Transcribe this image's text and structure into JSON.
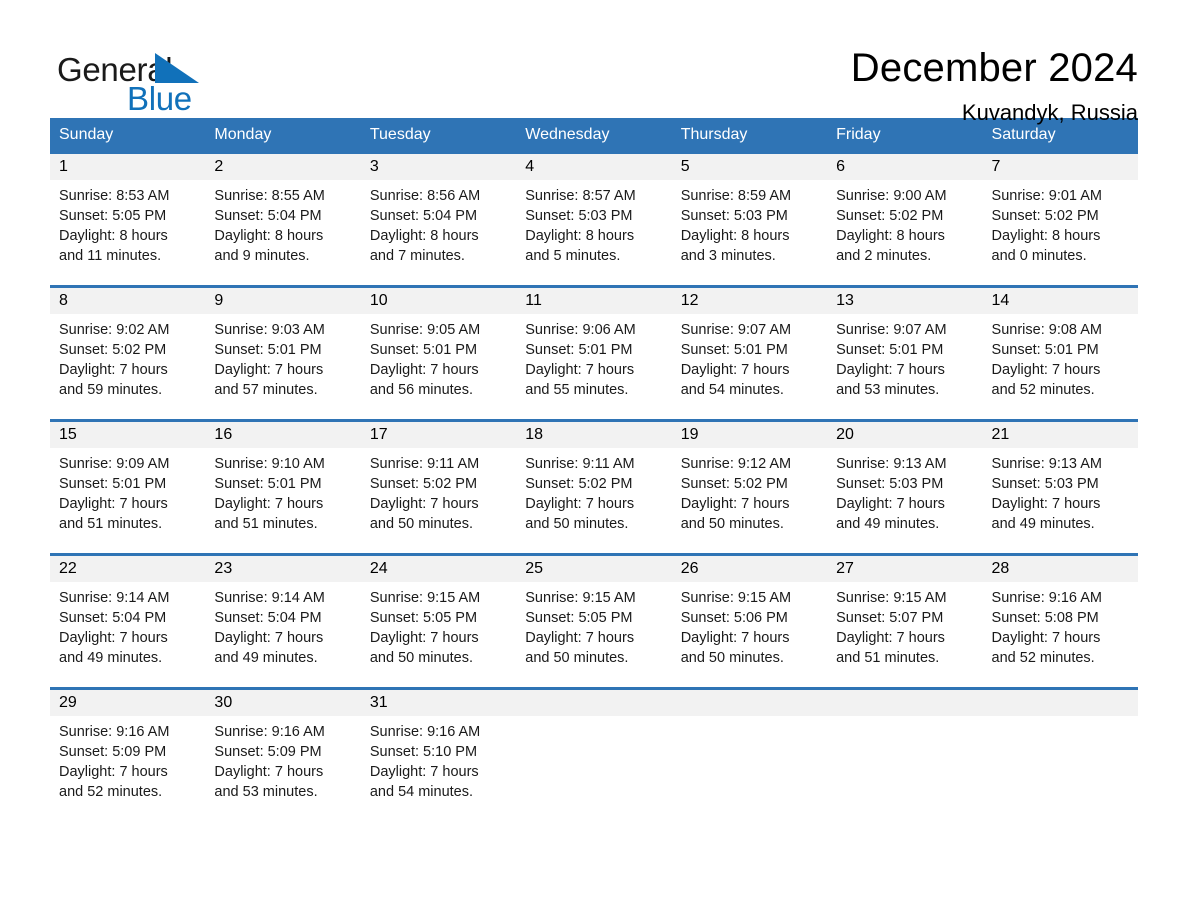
{
  "brand": {
    "name_part1": "General",
    "name_part2": "Blue",
    "triangle_icon": "triangle-icon",
    "accent_color": "#1171ba"
  },
  "header": {
    "title": "December 2024",
    "subtitle": "Kuvandyk, Russia"
  },
  "calendar": {
    "header_bg_color": "#2f74b5",
    "row_divider_color": "#2f74b5",
    "day_band_color": "#f2f2f2",
    "weekdays": [
      "Sunday",
      "Monday",
      "Tuesday",
      "Wednesday",
      "Thursday",
      "Friday",
      "Saturday"
    ],
    "weeks": [
      [
        {
          "day": "1",
          "sunrise": "Sunrise: 8:53 AM",
          "sunset": "Sunset: 5:05 PM",
          "daylight_line1": "Daylight: 8 hours",
          "daylight_line2": "and 11 minutes."
        },
        {
          "day": "2",
          "sunrise": "Sunrise: 8:55 AM",
          "sunset": "Sunset: 5:04 PM",
          "daylight_line1": "Daylight: 8 hours",
          "daylight_line2": "and 9 minutes."
        },
        {
          "day": "3",
          "sunrise": "Sunrise: 8:56 AM",
          "sunset": "Sunset: 5:04 PM",
          "daylight_line1": "Daylight: 8 hours",
          "daylight_line2": "and 7 minutes."
        },
        {
          "day": "4",
          "sunrise": "Sunrise: 8:57 AM",
          "sunset": "Sunset: 5:03 PM",
          "daylight_line1": "Daylight: 8 hours",
          "daylight_line2": "and 5 minutes."
        },
        {
          "day": "5",
          "sunrise": "Sunrise: 8:59 AM",
          "sunset": "Sunset: 5:03 PM",
          "daylight_line1": "Daylight: 8 hours",
          "daylight_line2": "and 3 minutes."
        },
        {
          "day": "6",
          "sunrise": "Sunrise: 9:00 AM",
          "sunset": "Sunset: 5:02 PM",
          "daylight_line1": "Daylight: 8 hours",
          "daylight_line2": "and 2 minutes."
        },
        {
          "day": "7",
          "sunrise": "Sunrise: 9:01 AM",
          "sunset": "Sunset: 5:02 PM",
          "daylight_line1": "Daylight: 8 hours",
          "daylight_line2": "and 0 minutes."
        }
      ],
      [
        {
          "day": "8",
          "sunrise": "Sunrise: 9:02 AM",
          "sunset": "Sunset: 5:02 PM",
          "daylight_line1": "Daylight: 7 hours",
          "daylight_line2": "and 59 minutes."
        },
        {
          "day": "9",
          "sunrise": "Sunrise: 9:03 AM",
          "sunset": "Sunset: 5:01 PM",
          "daylight_line1": "Daylight: 7 hours",
          "daylight_line2": "and 57 minutes."
        },
        {
          "day": "10",
          "sunrise": "Sunrise: 9:05 AM",
          "sunset": "Sunset: 5:01 PM",
          "daylight_line1": "Daylight: 7 hours",
          "daylight_line2": "and 56 minutes."
        },
        {
          "day": "11",
          "sunrise": "Sunrise: 9:06 AM",
          "sunset": "Sunset: 5:01 PM",
          "daylight_line1": "Daylight: 7 hours",
          "daylight_line2": "and 55 minutes."
        },
        {
          "day": "12",
          "sunrise": "Sunrise: 9:07 AM",
          "sunset": "Sunset: 5:01 PM",
          "daylight_line1": "Daylight: 7 hours",
          "daylight_line2": "and 54 minutes."
        },
        {
          "day": "13",
          "sunrise": "Sunrise: 9:07 AM",
          "sunset": "Sunset: 5:01 PM",
          "daylight_line1": "Daylight: 7 hours",
          "daylight_line2": "and 53 minutes."
        },
        {
          "day": "14",
          "sunrise": "Sunrise: 9:08 AM",
          "sunset": "Sunset: 5:01 PM",
          "daylight_line1": "Daylight: 7 hours",
          "daylight_line2": "and 52 minutes."
        }
      ],
      [
        {
          "day": "15",
          "sunrise": "Sunrise: 9:09 AM",
          "sunset": "Sunset: 5:01 PM",
          "daylight_line1": "Daylight: 7 hours",
          "daylight_line2": "and 51 minutes."
        },
        {
          "day": "16",
          "sunrise": "Sunrise: 9:10 AM",
          "sunset": "Sunset: 5:01 PM",
          "daylight_line1": "Daylight: 7 hours",
          "daylight_line2": "and 51 minutes."
        },
        {
          "day": "17",
          "sunrise": "Sunrise: 9:11 AM",
          "sunset": "Sunset: 5:02 PM",
          "daylight_line1": "Daylight: 7 hours",
          "daylight_line2": "and 50 minutes."
        },
        {
          "day": "18",
          "sunrise": "Sunrise: 9:11 AM",
          "sunset": "Sunset: 5:02 PM",
          "daylight_line1": "Daylight: 7 hours",
          "daylight_line2": "and 50 minutes."
        },
        {
          "day": "19",
          "sunrise": "Sunrise: 9:12 AM",
          "sunset": "Sunset: 5:02 PM",
          "daylight_line1": "Daylight: 7 hours",
          "daylight_line2": "and 50 minutes."
        },
        {
          "day": "20",
          "sunrise": "Sunrise: 9:13 AM",
          "sunset": "Sunset: 5:03 PM",
          "daylight_line1": "Daylight: 7 hours",
          "daylight_line2": "and 49 minutes."
        },
        {
          "day": "21",
          "sunrise": "Sunrise: 9:13 AM",
          "sunset": "Sunset: 5:03 PM",
          "daylight_line1": "Daylight: 7 hours",
          "daylight_line2": "and 49 minutes."
        }
      ],
      [
        {
          "day": "22",
          "sunrise": "Sunrise: 9:14 AM",
          "sunset": "Sunset: 5:04 PM",
          "daylight_line1": "Daylight: 7 hours",
          "daylight_line2": "and 49 minutes."
        },
        {
          "day": "23",
          "sunrise": "Sunrise: 9:14 AM",
          "sunset": "Sunset: 5:04 PM",
          "daylight_line1": "Daylight: 7 hours",
          "daylight_line2": "and 49 minutes."
        },
        {
          "day": "24",
          "sunrise": "Sunrise: 9:15 AM",
          "sunset": "Sunset: 5:05 PM",
          "daylight_line1": "Daylight: 7 hours",
          "daylight_line2": "and 50 minutes."
        },
        {
          "day": "25",
          "sunrise": "Sunrise: 9:15 AM",
          "sunset": "Sunset: 5:05 PM",
          "daylight_line1": "Daylight: 7 hours",
          "daylight_line2": "and 50 minutes."
        },
        {
          "day": "26",
          "sunrise": "Sunrise: 9:15 AM",
          "sunset": "Sunset: 5:06 PM",
          "daylight_line1": "Daylight: 7 hours",
          "daylight_line2": "and 50 minutes."
        },
        {
          "day": "27",
          "sunrise": "Sunrise: 9:15 AM",
          "sunset": "Sunset: 5:07 PM",
          "daylight_line1": "Daylight: 7 hours",
          "daylight_line2": "and 51 minutes."
        },
        {
          "day": "28",
          "sunrise": "Sunrise: 9:16 AM",
          "sunset": "Sunset: 5:08 PM",
          "daylight_line1": "Daylight: 7 hours",
          "daylight_line2": "and 52 minutes."
        }
      ],
      [
        {
          "day": "29",
          "sunrise": "Sunrise: 9:16 AM",
          "sunset": "Sunset: 5:09 PM",
          "daylight_line1": "Daylight: 7 hours",
          "daylight_line2": "and 52 minutes."
        },
        {
          "day": "30",
          "sunrise": "Sunrise: 9:16 AM",
          "sunset": "Sunset: 5:09 PM",
          "daylight_line1": "Daylight: 7 hours",
          "daylight_line2": "and 53 minutes."
        },
        {
          "day": "31",
          "sunrise": "Sunrise: 9:16 AM",
          "sunset": "Sunset: 5:10 PM",
          "daylight_line1": "Daylight: 7 hours",
          "daylight_line2": "and 54 minutes."
        },
        {
          "day": "",
          "sunrise": "",
          "sunset": "",
          "daylight_line1": "",
          "daylight_line2": ""
        },
        {
          "day": "",
          "sunrise": "",
          "sunset": "",
          "daylight_line1": "",
          "daylight_line2": ""
        },
        {
          "day": "",
          "sunrise": "",
          "sunset": "",
          "daylight_line1": "",
          "daylight_line2": ""
        },
        {
          "day": "",
          "sunrise": "",
          "sunset": "",
          "daylight_line1": "",
          "daylight_line2": ""
        }
      ]
    ]
  }
}
